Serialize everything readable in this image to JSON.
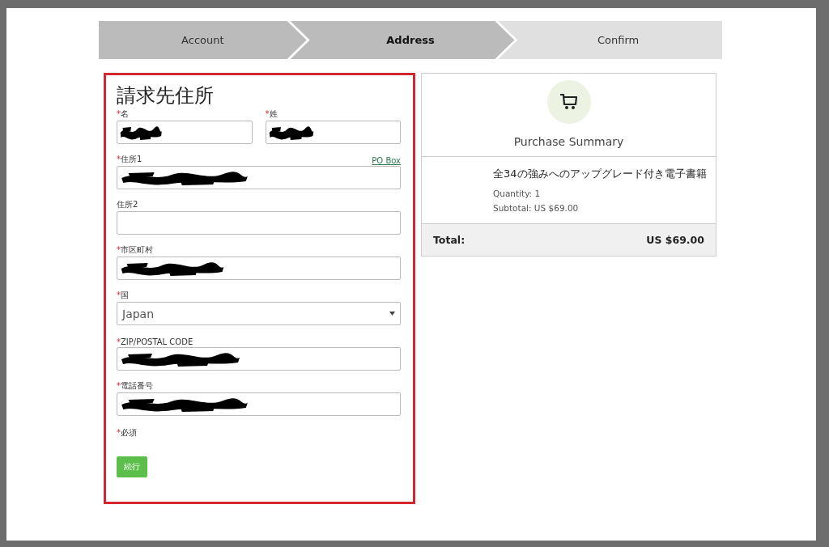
{
  "steps": [
    {
      "label": "Account",
      "selected": false,
      "done": true
    },
    {
      "label": "Address",
      "selected": true,
      "done": true
    },
    {
      "label": "Confirm",
      "selected": false,
      "done": false
    }
  ],
  "form": {
    "title": "請求先住所",
    "required_mark": "*",
    "rows": [
      [
        {
          "label": "名",
          "required": true,
          "kind": "text",
          "redacted": true
        },
        {
          "label": "姓",
          "required": true,
          "kind": "text",
          "redacted": true
        }
      ],
      [
        {
          "label": "住所1",
          "required": true,
          "kind": "text",
          "redacted": true,
          "link": "PO Box"
        }
      ],
      [
        {
          "label": "住所2",
          "required": false,
          "kind": "text"
        }
      ],
      [
        {
          "label": "市区町村",
          "required": true,
          "kind": "text",
          "redacted": true
        }
      ],
      [
        {
          "label": "国",
          "required": true,
          "kind": "select",
          "value": "Japan"
        }
      ],
      [
        {
          "label": "ZIP/POSTAL CODE",
          "required": true,
          "kind": "text",
          "redacted": true
        }
      ],
      [
        {
          "label": "電話番号",
          "required": true,
          "kind": "text",
          "redacted": true
        }
      ]
    ],
    "required_note": "必須",
    "submit": "続行"
  },
  "summary": {
    "title": "Purchase Summary",
    "item": "全34の強みへのアップグレード付き電子書籍",
    "quantity": "Quantity: 1",
    "subtotal": "Subtotal: US $69.00",
    "total_label": "Total:",
    "total": "US $69.00"
  }
}
